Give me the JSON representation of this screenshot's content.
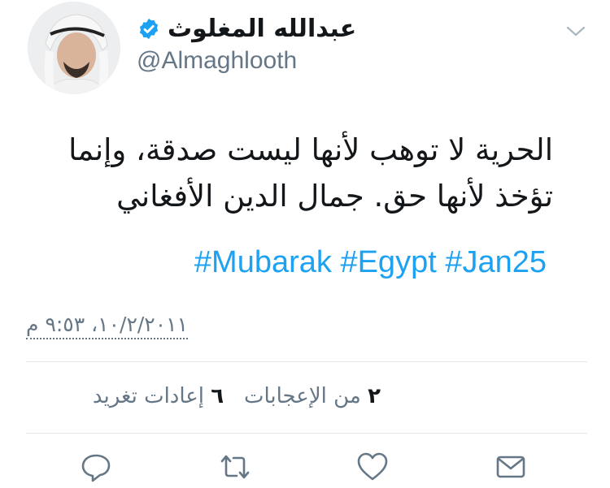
{
  "tweet": {
    "author": {
      "display_name": "عبدالله المغلوث",
      "handle": "@Almaghlooth",
      "verified": true
    },
    "text_lines": [
      "الحرية لا توهب لأنها ليست صدقة، وإنما",
      "تؤخذ لأنها حق. جمال الدين الأفغاني"
    ],
    "hashtags": [
      "#Mubarak",
      "#Egypt",
      "#Jan25"
    ],
    "timestamp": "١٠/٢/٢٠١١، ٩:٥٣ م",
    "stats": {
      "likes_count": "٢",
      "likes_label": "من الإعجابات",
      "retweets_count": "٦",
      "retweets_label": "إعادات تغريد"
    }
  },
  "icons": {
    "verified": "verified-badge-icon",
    "caret": "chevron-down-icon",
    "reply": "reply-icon",
    "retweet": "retweet-icon",
    "like": "heart-icon",
    "dm": "envelope-icon"
  },
  "colors": {
    "link": "#1da1f2",
    "secondary": "#657786",
    "divider": "#e1e8ed",
    "text": "#14171a"
  }
}
